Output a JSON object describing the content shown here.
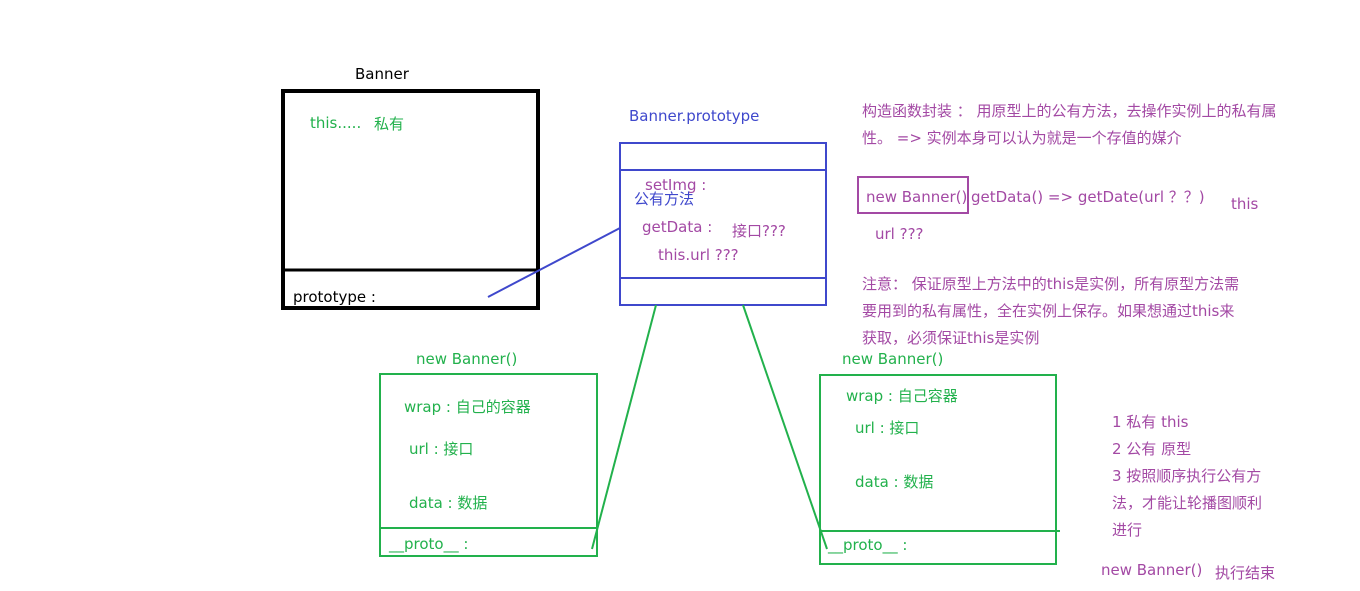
{
  "banner": {
    "title": "Banner",
    "this_label": "this.....",
    "private_label": "私有",
    "prototype_label": "prototype :"
  },
  "proto_box": {
    "title": "Banner.prototype",
    "setimg": "setImg :",
    "public_methods": "公有方法",
    "getdata": "getData :",
    "interface_q": "接口???",
    "this_url": "this.url ???"
  },
  "instance_left": {
    "title": "new Banner()",
    "wrap": "wrap : 自己的容器",
    "url": "url : 接口",
    "data": "data : 数据",
    "proto": "__proto__ :"
  },
  "instance_right": {
    "title": "new Banner()",
    "wrap": "wrap : 自己容器",
    "url": "url : 接口",
    "data": "data : 数据",
    "proto": "__proto__ :"
  },
  "notes": {
    "ctor_line1": "构造函数封装 ： 用原型上的公有方法，去操作实例上的私有属",
    "ctor_line2": "性。 => 实例本身可以认为就是一个存值的媒介",
    "new_banner_boxed": "new Banner()",
    "getdata_expr": "getData() => getDate(url ？？)",
    "this_word": "this",
    "url_q": "url ???",
    "attention_line1": "注意： 保证原型上方法中的this是实例，所有原型方法需",
    "attention_line2": "要用到的私有属性，全在实例上保存。如果想通过this来",
    "attention_line3": "获取，必须保证this是实例",
    "list_line1": "1 私有  this",
    "list_line2": "2 公有 原型",
    "list_line3": "3 按照顺序执行公有方",
    "list_line4": "法，才能让轮播图顺利",
    "list_line5": "进行",
    "final_new": "new Banner()",
    "final_done": "执行结束"
  },
  "colors": {
    "black": "#000000",
    "blue": "#3f48cc",
    "green": "#22b14c",
    "purple": "#a349a4"
  }
}
